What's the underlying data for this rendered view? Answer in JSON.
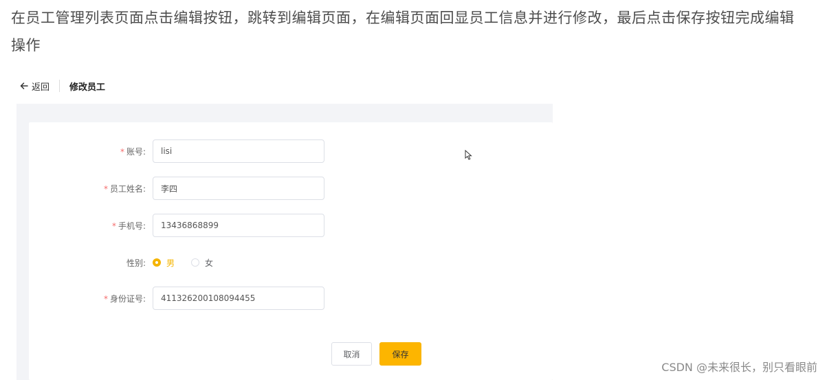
{
  "intro_text": "在员工管理列表页面点击编辑按钮，跳转到编辑页面，在编辑页面回显员工信息并进行修改，最后点击保存按钮完成编辑操作",
  "header": {
    "back_label": "返回",
    "title": "修改员工"
  },
  "form": {
    "account": {
      "label": "账号:",
      "value": "lisi",
      "required": true
    },
    "name": {
      "label": "员工姓名:",
      "value": "李四",
      "required": true
    },
    "phone": {
      "label": "手机号:",
      "value": "13436868899",
      "required": true
    },
    "gender": {
      "label": "性别:",
      "options": [
        "男",
        "女"
      ],
      "selected": "男"
    },
    "id_card": {
      "label": "身份证号:",
      "value": "411326200108094455",
      "required": true
    },
    "required_mark": "*"
  },
  "buttons": {
    "cancel": "取消",
    "save": "保存"
  },
  "watermark": "CSDN @未来很长，别只看眼前",
  "colors": {
    "accent": "#fdb500",
    "required": "#f56c6c",
    "page_bg": "#f3f4f7"
  }
}
